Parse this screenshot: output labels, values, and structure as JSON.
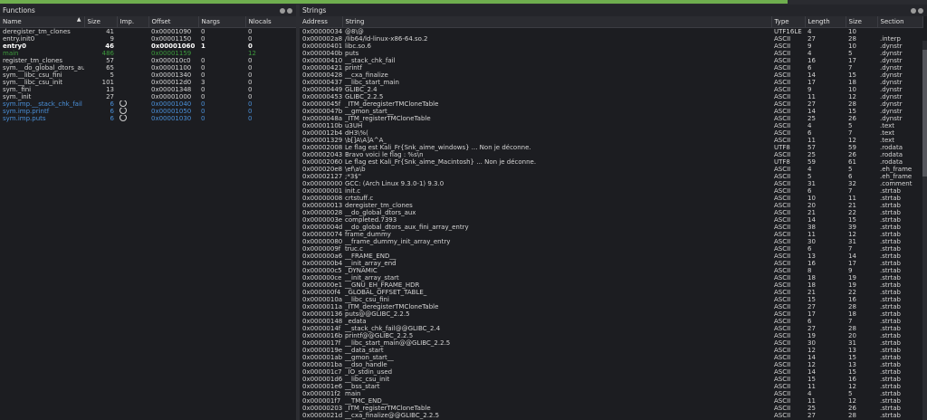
{
  "topbar": {
    "progress": 0.85
  },
  "functions": {
    "title": "Functions",
    "columns": [
      "Name",
      "Size",
      "Imp.",
      "Offset",
      "Nargs",
      "Nlocals"
    ],
    "rows": [
      {
        "name": "deregister_tm_clones",
        "size": "41",
        "imp": "",
        "offset": "0x00001090",
        "nargs": "0",
        "nlocals": "0",
        "style": "normal"
      },
      {
        "name": "entry.init0",
        "size": "9",
        "imp": "",
        "offset": "0x00001150",
        "nargs": "0",
        "nlocals": "0",
        "style": "normal"
      },
      {
        "name": "entry0",
        "size": "46",
        "imp": "",
        "offset": "0x00001060",
        "nargs": "1",
        "nlocals": "0",
        "style": "bold"
      },
      {
        "name": "main",
        "size": "486",
        "imp": "",
        "offset": "0x00001159",
        "nargs": "",
        "nlocals": "12",
        "style": "green"
      },
      {
        "name": "register_tm_clones",
        "size": "57",
        "imp": "",
        "offset": "0x000010c0",
        "nargs": "0",
        "nlocals": "0",
        "style": "normal"
      },
      {
        "name": "sym.__do_global_dtors_aux",
        "size": "65",
        "imp": "",
        "offset": "0x00001100",
        "nargs": "0",
        "nlocals": "0",
        "style": "normal"
      },
      {
        "name": "sym.__libc_csu_fini",
        "size": "5",
        "imp": "",
        "offset": "0x00001340",
        "nargs": "0",
        "nlocals": "0",
        "style": "normal"
      },
      {
        "name": "sym.__libc_csu_init",
        "size": "101",
        "imp": "",
        "offset": "0x000012d0",
        "nargs": "3",
        "nlocals": "0",
        "style": "normal"
      },
      {
        "name": "sym._fini",
        "size": "13",
        "imp": "",
        "offset": "0x00001348",
        "nargs": "0",
        "nlocals": "0",
        "style": "normal"
      },
      {
        "name": "sym._init",
        "size": "27",
        "imp": "",
        "offset": "0x00001000",
        "nargs": "0",
        "nlocals": "0",
        "style": "normal"
      },
      {
        "name": "sym.imp.__stack_chk_fail",
        "size": "6",
        "imp": "icon",
        "offset": "0x00001040",
        "nargs": "0",
        "nlocals": "0",
        "style": "blue"
      },
      {
        "name": "sym.imp.printf",
        "size": "6",
        "imp": "icon",
        "offset": "0x00001050",
        "nargs": "0",
        "nlocals": "0",
        "style": "blue"
      },
      {
        "name": "sym.imp.puts",
        "size": "6",
        "imp": "icon",
        "offset": "0x00001030",
        "nargs": "0",
        "nlocals": "0",
        "style": "blue"
      }
    ]
  },
  "strings": {
    "title": "Strings",
    "columns": [
      "Address",
      "String",
      "Type",
      "Length",
      "Size",
      "Section"
    ],
    "rows": [
      [
        "0x00000034",
        "@8\\@",
        "UTF16LE",
        "4",
        "10",
        ""
      ],
      [
        "0x000002a8",
        "/lib64/ld-linux-x86-64.so.2",
        "ASCII",
        "27",
        "28",
        ".interp"
      ],
      [
        "0x00000401",
        "libc.so.6",
        "ASCII",
        "9",
        "10",
        ".dynstr"
      ],
      [
        "0x0000040b",
        "puts",
        "ASCII",
        "4",
        "5",
        ".dynstr"
      ],
      [
        "0x00000410",
        "__stack_chk_fail",
        "ASCII",
        "16",
        "17",
        ".dynstr"
      ],
      [
        "0x00000421",
        "printf",
        "ASCII",
        "6",
        "7",
        ".dynstr"
      ],
      [
        "0x00000428",
        "__cxa_finalize",
        "ASCII",
        "14",
        "15",
        ".dynstr"
      ],
      [
        "0x00000437",
        "__libc_start_main",
        "ASCII",
        "17",
        "18",
        ".dynstr"
      ],
      [
        "0x00000449",
        "GLIBC_2.4",
        "ASCII",
        "9",
        "10",
        ".dynstr"
      ],
      [
        "0x00000453",
        "GLIBC_2.2.5",
        "ASCII",
        "11",
        "12",
        ".dynstr"
      ],
      [
        "0x0000045f",
        "_ITM_deregisterTMCloneTable",
        "ASCII",
        "27",
        "28",
        ".dynstr"
      ],
      [
        "0x0000047b",
        "__gmon_start__",
        "ASCII",
        "14",
        "15",
        ".dynstr"
      ],
      [
        "0x0000048a",
        "_ITM_registerTMCloneTable",
        "ASCII",
        "25",
        "26",
        ".dynstr"
      ],
      [
        "0x0000110b",
        "u3UH",
        "ASCII",
        "4",
        "5",
        ".text"
      ],
      [
        "0x000012b4",
        "dH3\\%(",
        "ASCII",
        "6",
        "7",
        ".text"
      ],
      [
        "0x00001329",
        "\\b[]A\\A]A^A_",
        "ASCII",
        "11",
        "12",
        ".text"
      ],
      [
        "0x00002008",
        "Le flag est Kali_Fr{Snk_aime_windows} ... Non je déconne.",
        "UTF8",
        "57",
        "59",
        ".rodata"
      ],
      [
        "0x00002043",
        "Bravo voici le flag : %s\\n",
        "ASCII",
        "25",
        "26",
        ".rodata"
      ],
      [
        "0x00002060",
        "Le flag est Kali_Fr{Snk_aime_Macintosh} ... Non je déconne.",
        "UTF8",
        "59",
        "61",
        ".rodata"
      ],
      [
        "0x000020e8",
        "\\ef\\a\\b",
        "ASCII",
        "4",
        "5",
        ".eh_frame"
      ],
      [
        "0x00002127",
        ";*3$\"",
        "ASCII",
        "5",
        "6",
        ".eh_frame"
      ],
      [
        "0x00000000",
        "GCC: (Arch Linux 9.3.0-1) 9.3.0",
        "ASCII",
        "31",
        "32",
        ".comment"
      ],
      [
        "0x00000001",
        "init.c",
        "ASCII",
        "6",
        "7",
        ".strtab"
      ],
      [
        "0x00000008",
        "crtstuff.c",
        "ASCII",
        "10",
        "11",
        ".strtab"
      ],
      [
        "0x00000013",
        "deregister_tm_clones",
        "ASCII",
        "20",
        "21",
        ".strtab"
      ],
      [
        "0x00000028",
        "__do_global_dtors_aux",
        "ASCII",
        "21",
        "22",
        ".strtab"
      ],
      [
        "0x0000003e",
        "completed.7393",
        "ASCII",
        "14",
        "15",
        ".strtab"
      ],
      [
        "0x0000004d",
        "__do_global_dtors_aux_fini_array_entry",
        "ASCII",
        "38",
        "39",
        ".strtab"
      ],
      [
        "0x00000074",
        "frame_dummy",
        "ASCII",
        "11",
        "12",
        ".strtab"
      ],
      [
        "0x00000080",
        "__frame_dummy_init_array_entry",
        "ASCII",
        "30",
        "31",
        ".strtab"
      ],
      [
        "0x0000009f",
        "truc.c",
        "ASCII",
        "6",
        "7",
        ".strtab"
      ],
      [
        "0x000000a6",
        "__FRAME_END__",
        "ASCII",
        "13",
        "14",
        ".strtab"
      ],
      [
        "0x000000b4",
        "__init_array_end",
        "ASCII",
        "16",
        "17",
        ".strtab"
      ],
      [
        "0x000000c5",
        "_DYNAMIC",
        "ASCII",
        "8",
        "9",
        ".strtab"
      ],
      [
        "0x000000ce",
        "__init_array_start",
        "ASCII",
        "18",
        "19",
        ".strtab"
      ],
      [
        "0x000000e1",
        "__GNU_EH_FRAME_HDR",
        "ASCII",
        "18",
        "19",
        ".strtab"
      ],
      [
        "0x000000f4",
        "_GLOBAL_OFFSET_TABLE_",
        "ASCII",
        "21",
        "22",
        ".strtab"
      ],
      [
        "0x0000010a",
        "__libc_csu_fini",
        "ASCII",
        "15",
        "16",
        ".strtab"
      ],
      [
        "0x0000011a",
        "_ITM_deregisterTMCloneTable",
        "ASCII",
        "27",
        "28",
        ".strtab"
      ],
      [
        "0x00000136",
        "puts@@GLIBC_2.2.5",
        "ASCII",
        "17",
        "18",
        ".strtab"
      ],
      [
        "0x00000148",
        "_edata",
        "ASCII",
        "6",
        "7",
        ".strtab"
      ],
      [
        "0x0000014f",
        "__stack_chk_fail@@GLIBC_2.4",
        "ASCII",
        "27",
        "28",
        ".strtab"
      ],
      [
        "0x0000016b",
        "printf@@GLIBC_2.2.5",
        "ASCII",
        "19",
        "20",
        ".strtab"
      ],
      [
        "0x0000017f",
        "__libc_start_main@@GLIBC_2.2.5",
        "ASCII",
        "30",
        "31",
        ".strtab"
      ],
      [
        "0x0000019e",
        "__data_start",
        "ASCII",
        "12",
        "13",
        ".strtab"
      ],
      [
        "0x000001ab",
        "__gmon_start__",
        "ASCII",
        "14",
        "15",
        ".strtab"
      ],
      [
        "0x000001ba",
        "__dso_handle",
        "ASCII",
        "12",
        "13",
        ".strtab"
      ],
      [
        "0x000001c7",
        "_IO_stdin_used",
        "ASCII",
        "14",
        "15",
        ".strtab"
      ],
      [
        "0x000001d6",
        "__libc_csu_init",
        "ASCII",
        "15",
        "16",
        ".strtab"
      ],
      [
        "0x000001e6",
        "__bss_start",
        "ASCII",
        "11",
        "12",
        ".strtab"
      ],
      [
        "0x000001f2",
        "main",
        "ASCII",
        "4",
        "5",
        ".strtab"
      ],
      [
        "0x000001f7",
        "__TMC_END__",
        "ASCII",
        "11",
        "12",
        ".strtab"
      ],
      [
        "0x00000203",
        "_ITM_registerTMCloneTable",
        "ASCII",
        "25",
        "26",
        ".strtab"
      ],
      [
        "0x0000021d",
        "__cxa_finalize@@GLIBC_2.2.5",
        "ASCII",
        "27",
        "28",
        ".strtab"
      ]
    ]
  }
}
